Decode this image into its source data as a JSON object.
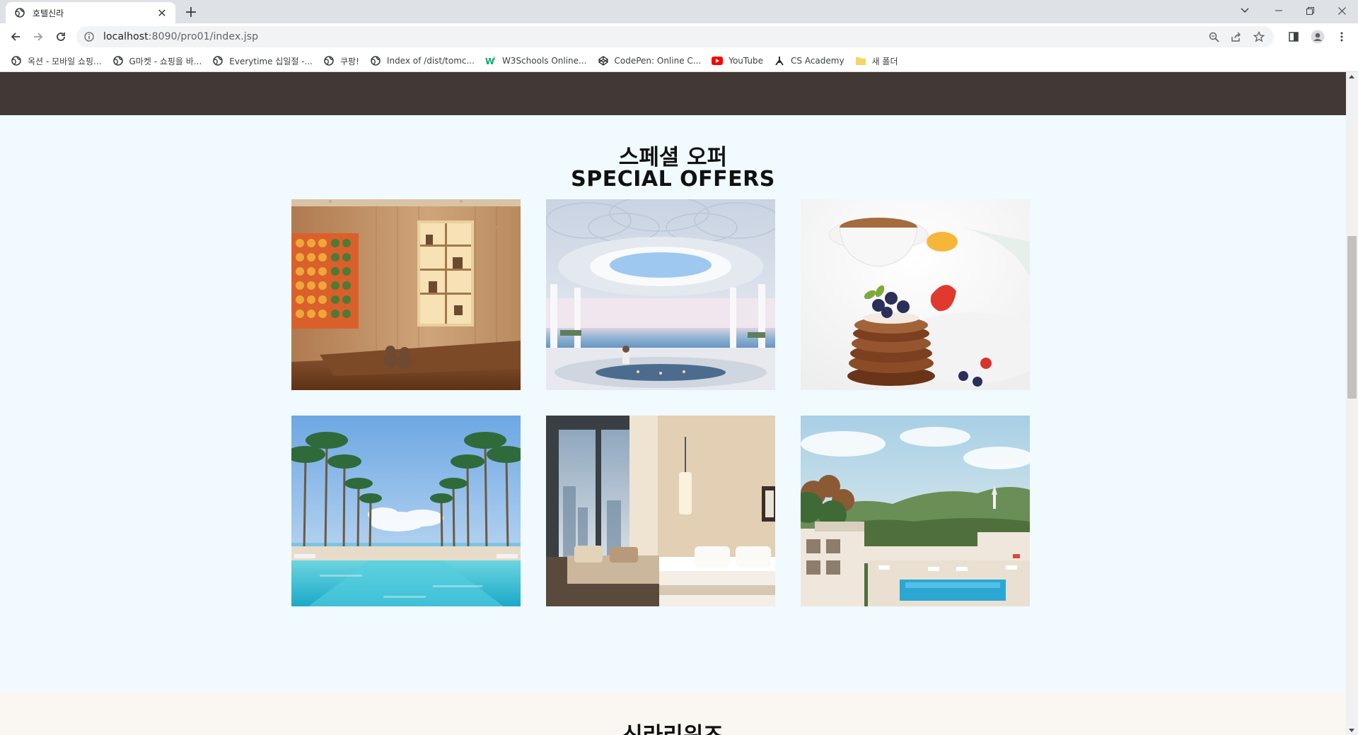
{
  "browser": {
    "tab": {
      "title": "호텔신라",
      "close": "✕"
    },
    "new_tab": "+",
    "url": {
      "host": "localhost",
      "rest": ":8090/pro01/index.jsp"
    },
    "bookmarks": [
      {
        "label": "옥션 - 모바일 쇼핑...",
        "icon": "globe-icon"
      },
      {
        "label": "G마켓 - 쇼핑을 바...",
        "icon": "globe-icon"
      },
      {
        "label": "Everytime 십일절 -...",
        "icon": "globe-icon"
      },
      {
        "label": "쿠팡!",
        "icon": "globe-icon"
      },
      {
        "label": "Index of /dist/tomc...",
        "icon": "globe-icon"
      },
      {
        "label": "W3Schools Online...",
        "icon": "w3schools-icon"
      },
      {
        "label": "CodePen: Online C...",
        "icon": "codepen-icon"
      },
      {
        "label": "YouTube",
        "icon": "youtube-icon"
      },
      {
        "label": "CS Academy",
        "icon": "cs-academy-icon"
      },
      {
        "label": "새 폴더",
        "icon": "folder-icon"
      }
    ]
  },
  "page": {
    "offers": {
      "title_ko": "스페셜 오퍼",
      "title_en": "SPECIAL OFFERS",
      "images": [
        {
          "subject": "room-with-teddy-bears"
        },
        {
          "subject": "rooftop-pool-ocean-view"
        },
        {
          "subject": "pancakes-and-tea"
        },
        {
          "subject": "palm-tree-pool"
        },
        {
          "subject": "hotel-bedroom-window"
        },
        {
          "subject": "outdoor-pool-mountain-view"
        }
      ]
    },
    "rewards": {
      "title": "신라리워즈"
    }
  },
  "colors": {
    "top_band": "#423936",
    "offers_bg": "#f1faff",
    "rewards_bg": "#faf7f2"
  }
}
